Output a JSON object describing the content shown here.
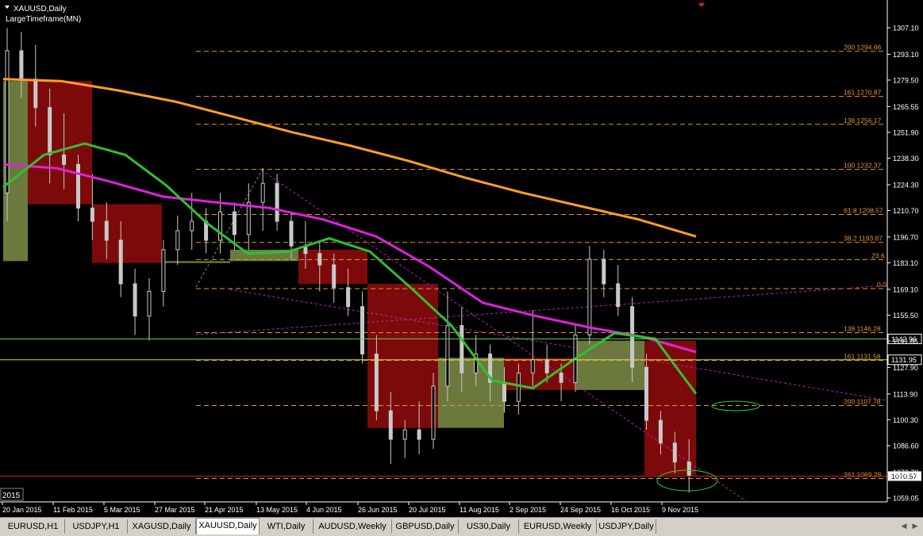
{
  "chart_header": {
    "symbol": "XAUUSD,Daily",
    "indicator": "LargeTimeframe(MN)"
  },
  "year_label": "2015",
  "tabs": [
    {
      "label": "EURUSD,H1",
      "active": false
    },
    {
      "label": "USDJPY,H1",
      "active": false
    },
    {
      "label": "XAGUSD,Daily",
      "active": false
    },
    {
      "label": "XAUUSD,Daily",
      "active": true
    },
    {
      "label": "WTI,Daily",
      "active": false
    },
    {
      "label": "AUDUSD,Weekly",
      "active": false
    },
    {
      "label": "GBPUSD,Daily",
      "active": false
    },
    {
      "label": "US30,Daily",
      "active": false
    },
    {
      "label": "EURUSD,Weekly",
      "active": false
    },
    {
      "label": "USDJPY,Daily",
      "active": false
    }
  ],
  "colors": {
    "background": "#000000",
    "grid": "#5a5a5a",
    "fib": "#e8962a",
    "ma_orange": "#ffa020",
    "ma_magenta": "#e020e0",
    "ma_green": "#30c030",
    "bear_box": "#7d0a0a",
    "bull_box": "#6b7a3c",
    "hline": "#64d264",
    "ellipse": "#30d030",
    "candle": "#c8c8c8"
  },
  "chart_data": {
    "type": "candlestick",
    "title": "XAUUSD,Daily",
    "ylim": [
      1055.5,
      1313.5
    ],
    "price_ticks": [
      1307.1,
      1293.1,
      1279.5,
      1265.55,
      1251.9,
      1238.3,
      1224.3,
      1210.7,
      1196.7,
      1183.1,
      1169.1,
      1155.5,
      1141.85,
      1127.9,
      1113.9,
      1100.3,
      1086.6,
      1072.7,
      1059.05
    ],
    "x_labels": [
      "20 Jan 2015",
      "11 Feb 2015",
      "5 Mar 2015",
      "27 Mar 2015",
      "21 Apr 2015",
      "13 May 2015",
      "4 Jun 2015",
      "26 Jun 2015",
      "20 Jul 2015",
      "11 Aug 2015",
      "2 Sep 2015",
      "24 Sep 2015",
      "16 Oct 2015",
      "9 Nov 2015"
    ],
    "current_price": "1070.57",
    "price_tags": [
      "1142.96",
      "1131.95"
    ],
    "monthly_boxes": [
      {
        "month": "Jan 2015",
        "open": 1184,
        "close": 1279,
        "high": 1307,
        "low": 1167,
        "dir": "bull"
      },
      {
        "month": "Feb 2015",
        "open": 1279,
        "close": 1214,
        "high": 1307,
        "low": 1196,
        "dir": "bear"
      },
      {
        "month": "Mar 2015",
        "open": 1214,
        "close": 1183,
        "high": 1222,
        "low": 1142,
        "dir": "bear"
      },
      {
        "month": "Apr 2015",
        "open": 1183,
        "close": 1184,
        "high": 1224,
        "low": 1169,
        "dir": "bull"
      },
      {
        "month": "May 2015",
        "open": 1184,
        "close": 1190,
        "high": 1232,
        "low": 1169,
        "dir": "bull"
      },
      {
        "month": "Jun 2015",
        "open": 1190,
        "close": 1172,
        "high": 1205,
        "low": 1162,
        "dir": "bear"
      },
      {
        "month": "Jul 2015",
        "open": 1172,
        "close": 1096,
        "high": 1172,
        "low": 1077,
        "dir": "bear"
      },
      {
        "month": "Aug 2015",
        "open": 1096,
        "close": 1133,
        "high": 1169,
        "low": 1081,
        "dir": "bull"
      },
      {
        "month": "Sep 2015",
        "open": 1133,
        "close": 1116,
        "high": 1158,
        "low": 1101,
        "dir": "bear"
      },
      {
        "month": "Oct 2015",
        "open": 1116,
        "close": 1142,
        "high": 1191,
        "low": 1102,
        "dir": "bull"
      },
      {
        "month": "Nov 2015",
        "open": 1142,
        "close": 1071,
        "high": 1142,
        "low": 1062,
        "dir": "bear"
      }
    ],
    "fib_levels": [
      {
        "ratio": "200",
        "price": "1294.66"
      },
      {
        "ratio": "161",
        "price": "1270.87"
      },
      {
        "ratio": "138",
        "price": "1256.17"
      },
      {
        "ratio": "100",
        "price": "1232.37"
      },
      {
        "ratio": "61.8",
        "price": "1208.57"
      },
      {
        "ratio": "38.2",
        "price": "1193.87"
      },
      {
        "ratio": "23.6",
        "price": ""
      },
      {
        "ratio": "0.0",
        "price": ""
      },
      {
        "ratio": "138",
        "price": "1146.28"
      },
      {
        "ratio": "161",
        "price": "1131.58"
      },
      {
        "ratio": "200",
        "price": "1107.78"
      },
      {
        "ratio": "261",
        "price": "1069.28"
      }
    ],
    "fib_values": [
      1294.66,
      1270.87,
      1256.17,
      1232.37,
      1208.57,
      1193.87,
      1184.8,
      1169.5,
      1146.28,
      1131.58,
      1107.78,
      1069.28
    ],
    "horizontal_lines": [
      {
        "price": 1142.96,
        "color": "#64d264"
      },
      {
        "price": 1131.95,
        "color": "#c8e050"
      },
      {
        "price": 1070.57,
        "color": "#d02020"
      }
    ],
    "ma_slow": [
      1280,
      1279,
      1274,
      1268,
      1260,
      1252,
      1245,
      1237,
      1228,
      1220,
      1213,
      1206,
      1197
    ],
    "ma_mid": [
      1235,
      1233,
      1226,
      1218,
      1215,
      1212,
      1206,
      1197,
      1181,
      1162,
      1155,
      1149,
      1144,
      1136
    ],
    "ma_fast": [
      1223,
      1240,
      1246,
      1240,
      1224,
      1204,
      1188,
      1189,
      1196,
      1189,
      1170,
      1150,
      1121,
      1117,
      1132,
      1146,
      1143,
      1114
    ],
    "candles": [
      {
        "o": 1220,
        "h": 1307,
        "l": 1205,
        "c": 1295
      },
      {
        "o": 1295,
        "h": 1305,
        "l": 1270,
        "c": 1280
      },
      {
        "o": 1280,
        "h": 1298,
        "l": 1255,
        "c": 1265
      },
      {
        "o": 1265,
        "h": 1275,
        "l": 1225,
        "c": 1240
      },
      {
        "o": 1240,
        "h": 1262,
        "l": 1222,
        "c": 1235
      },
      {
        "o": 1235,
        "h": 1240,
        "l": 1205,
        "c": 1212
      },
      {
        "o": 1212,
        "h": 1230,
        "l": 1195,
        "c": 1205
      },
      {
        "o": 1205,
        "h": 1215,
        "l": 1185,
        "c": 1195
      },
      {
        "o": 1195,
        "h": 1205,
        "l": 1165,
        "c": 1172
      },
      {
        "o": 1172,
        "h": 1180,
        "l": 1145,
        "c": 1155
      },
      {
        "o": 1155,
        "h": 1175,
        "l": 1142,
        "c": 1168
      },
      {
        "o": 1168,
        "h": 1195,
        "l": 1160,
        "c": 1190
      },
      {
        "o": 1190,
        "h": 1208,
        "l": 1182,
        "c": 1200
      },
      {
        "o": 1200,
        "h": 1220,
        "l": 1190,
        "c": 1205
      },
      {
        "o": 1205,
        "h": 1212,
        "l": 1188,
        "c": 1195
      },
      {
        "o": 1195,
        "h": 1220,
        "l": 1188,
        "c": 1210
      },
      {
        "o": 1210,
        "h": 1215,
        "l": 1190,
        "c": 1198
      },
      {
        "o": 1198,
        "h": 1225,
        "l": 1190,
        "c": 1215
      },
      {
        "o": 1215,
        "h": 1233,
        "l": 1200,
        "c": 1225
      },
      {
        "o": 1225,
        "h": 1230,
        "l": 1200,
        "c": 1205
      },
      {
        "o": 1205,
        "h": 1210,
        "l": 1185,
        "c": 1192
      },
      {
        "o": 1192,
        "h": 1205,
        "l": 1180,
        "c": 1188
      },
      {
        "o": 1188,
        "h": 1195,
        "l": 1168,
        "c": 1182
      },
      {
        "o": 1182,
        "h": 1188,
        "l": 1162,
        "c": 1170
      },
      {
        "o": 1170,
        "h": 1180,
        "l": 1155,
        "c": 1160
      },
      {
        "o": 1160,
        "h": 1168,
        "l": 1130,
        "c": 1135
      },
      {
        "o": 1135,
        "h": 1145,
        "l": 1100,
        "c": 1105
      },
      {
        "o": 1105,
        "h": 1115,
        "l": 1077,
        "c": 1090
      },
      {
        "o": 1090,
        "h": 1100,
        "l": 1080,
        "c": 1095
      },
      {
        "o": 1095,
        "h": 1110,
        "l": 1082,
        "c": 1090
      },
      {
        "o": 1090,
        "h": 1125,
        "l": 1085,
        "c": 1118
      },
      {
        "o": 1118,
        "h": 1168,
        "l": 1110,
        "c": 1150
      },
      {
        "o": 1150,
        "h": 1160,
        "l": 1115,
        "c": 1125
      },
      {
        "o": 1125,
        "h": 1145,
        "l": 1118,
        "c": 1135
      },
      {
        "o": 1135,
        "h": 1140,
        "l": 1110,
        "c": 1120
      },
      {
        "o": 1120,
        "h": 1128,
        "l": 1104,
        "c": 1110
      },
      {
        "o": 1110,
        "h": 1130,
        "l": 1103,
        "c": 1125
      },
      {
        "o": 1125,
        "h": 1158,
        "l": 1118,
        "c": 1132
      },
      {
        "o": 1132,
        "h": 1140,
        "l": 1120,
        "c": 1125
      },
      {
        "o": 1125,
        "h": 1130,
        "l": 1110,
        "c": 1120
      },
      {
        "o": 1120,
        "h": 1150,
        "l": 1115,
        "c": 1145
      },
      {
        "o": 1145,
        "h": 1192,
        "l": 1140,
        "c": 1185
      },
      {
        "o": 1185,
        "h": 1190,
        "l": 1165,
        "c": 1172
      },
      {
        "o": 1172,
        "h": 1182,
        "l": 1155,
        "c": 1160
      },
      {
        "o": 1160,
        "h": 1165,
        "l": 1120,
        "c": 1128
      },
      {
        "o": 1128,
        "h": 1135,
        "l": 1095,
        "c": 1100
      },
      {
        "o": 1100,
        "h": 1105,
        "l": 1082,
        "c": 1088
      },
      {
        "o": 1088,
        "h": 1094,
        "l": 1072,
        "c": 1078
      },
      {
        "o": 1078,
        "h": 1090,
        "l": 1062,
        "c": 1071
      }
    ]
  }
}
